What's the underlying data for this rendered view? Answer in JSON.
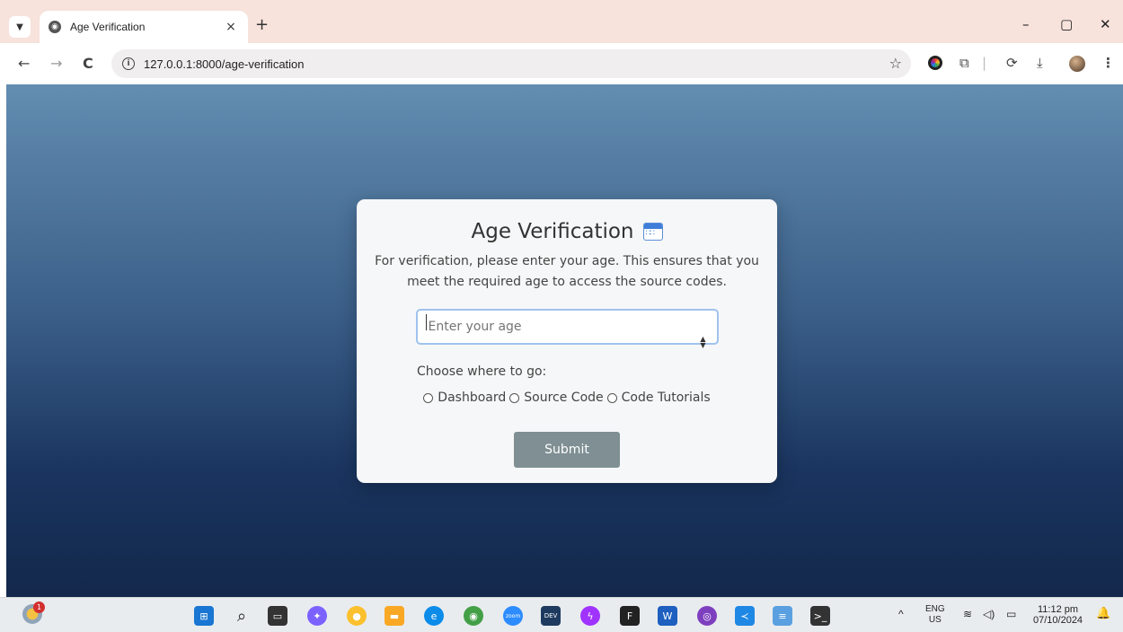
{
  "browser": {
    "tab_title": "Age Verification",
    "tab_close": "×",
    "new_tab": "+",
    "url": "127.0.0.1:8000/age-verification",
    "minimize": "–",
    "restore": "▢",
    "close": "✕",
    "back": "←",
    "forward": "→",
    "reload": "C"
  },
  "card": {
    "title": "Age Verification",
    "description": "For verification, please enter your age. This ensures that you meet the required age to access the source codes.",
    "age_placeholder": "Enter your age",
    "choose_label": "Choose where to go:",
    "options": [
      "Dashboard",
      "Source Code",
      "Code Tutorials"
    ],
    "submit_label": "Submit"
  },
  "taskbar": {
    "weather_badge": "1",
    "language_line1": "ENG",
    "language_line2": "US",
    "time": "11:12 pm",
    "date": "07/10/2024"
  },
  "colors": {
    "background_top": "#638db1",
    "background_bottom": "#13284b",
    "submit_button": "#7f8f94",
    "input_border": "#9fc3ee"
  }
}
